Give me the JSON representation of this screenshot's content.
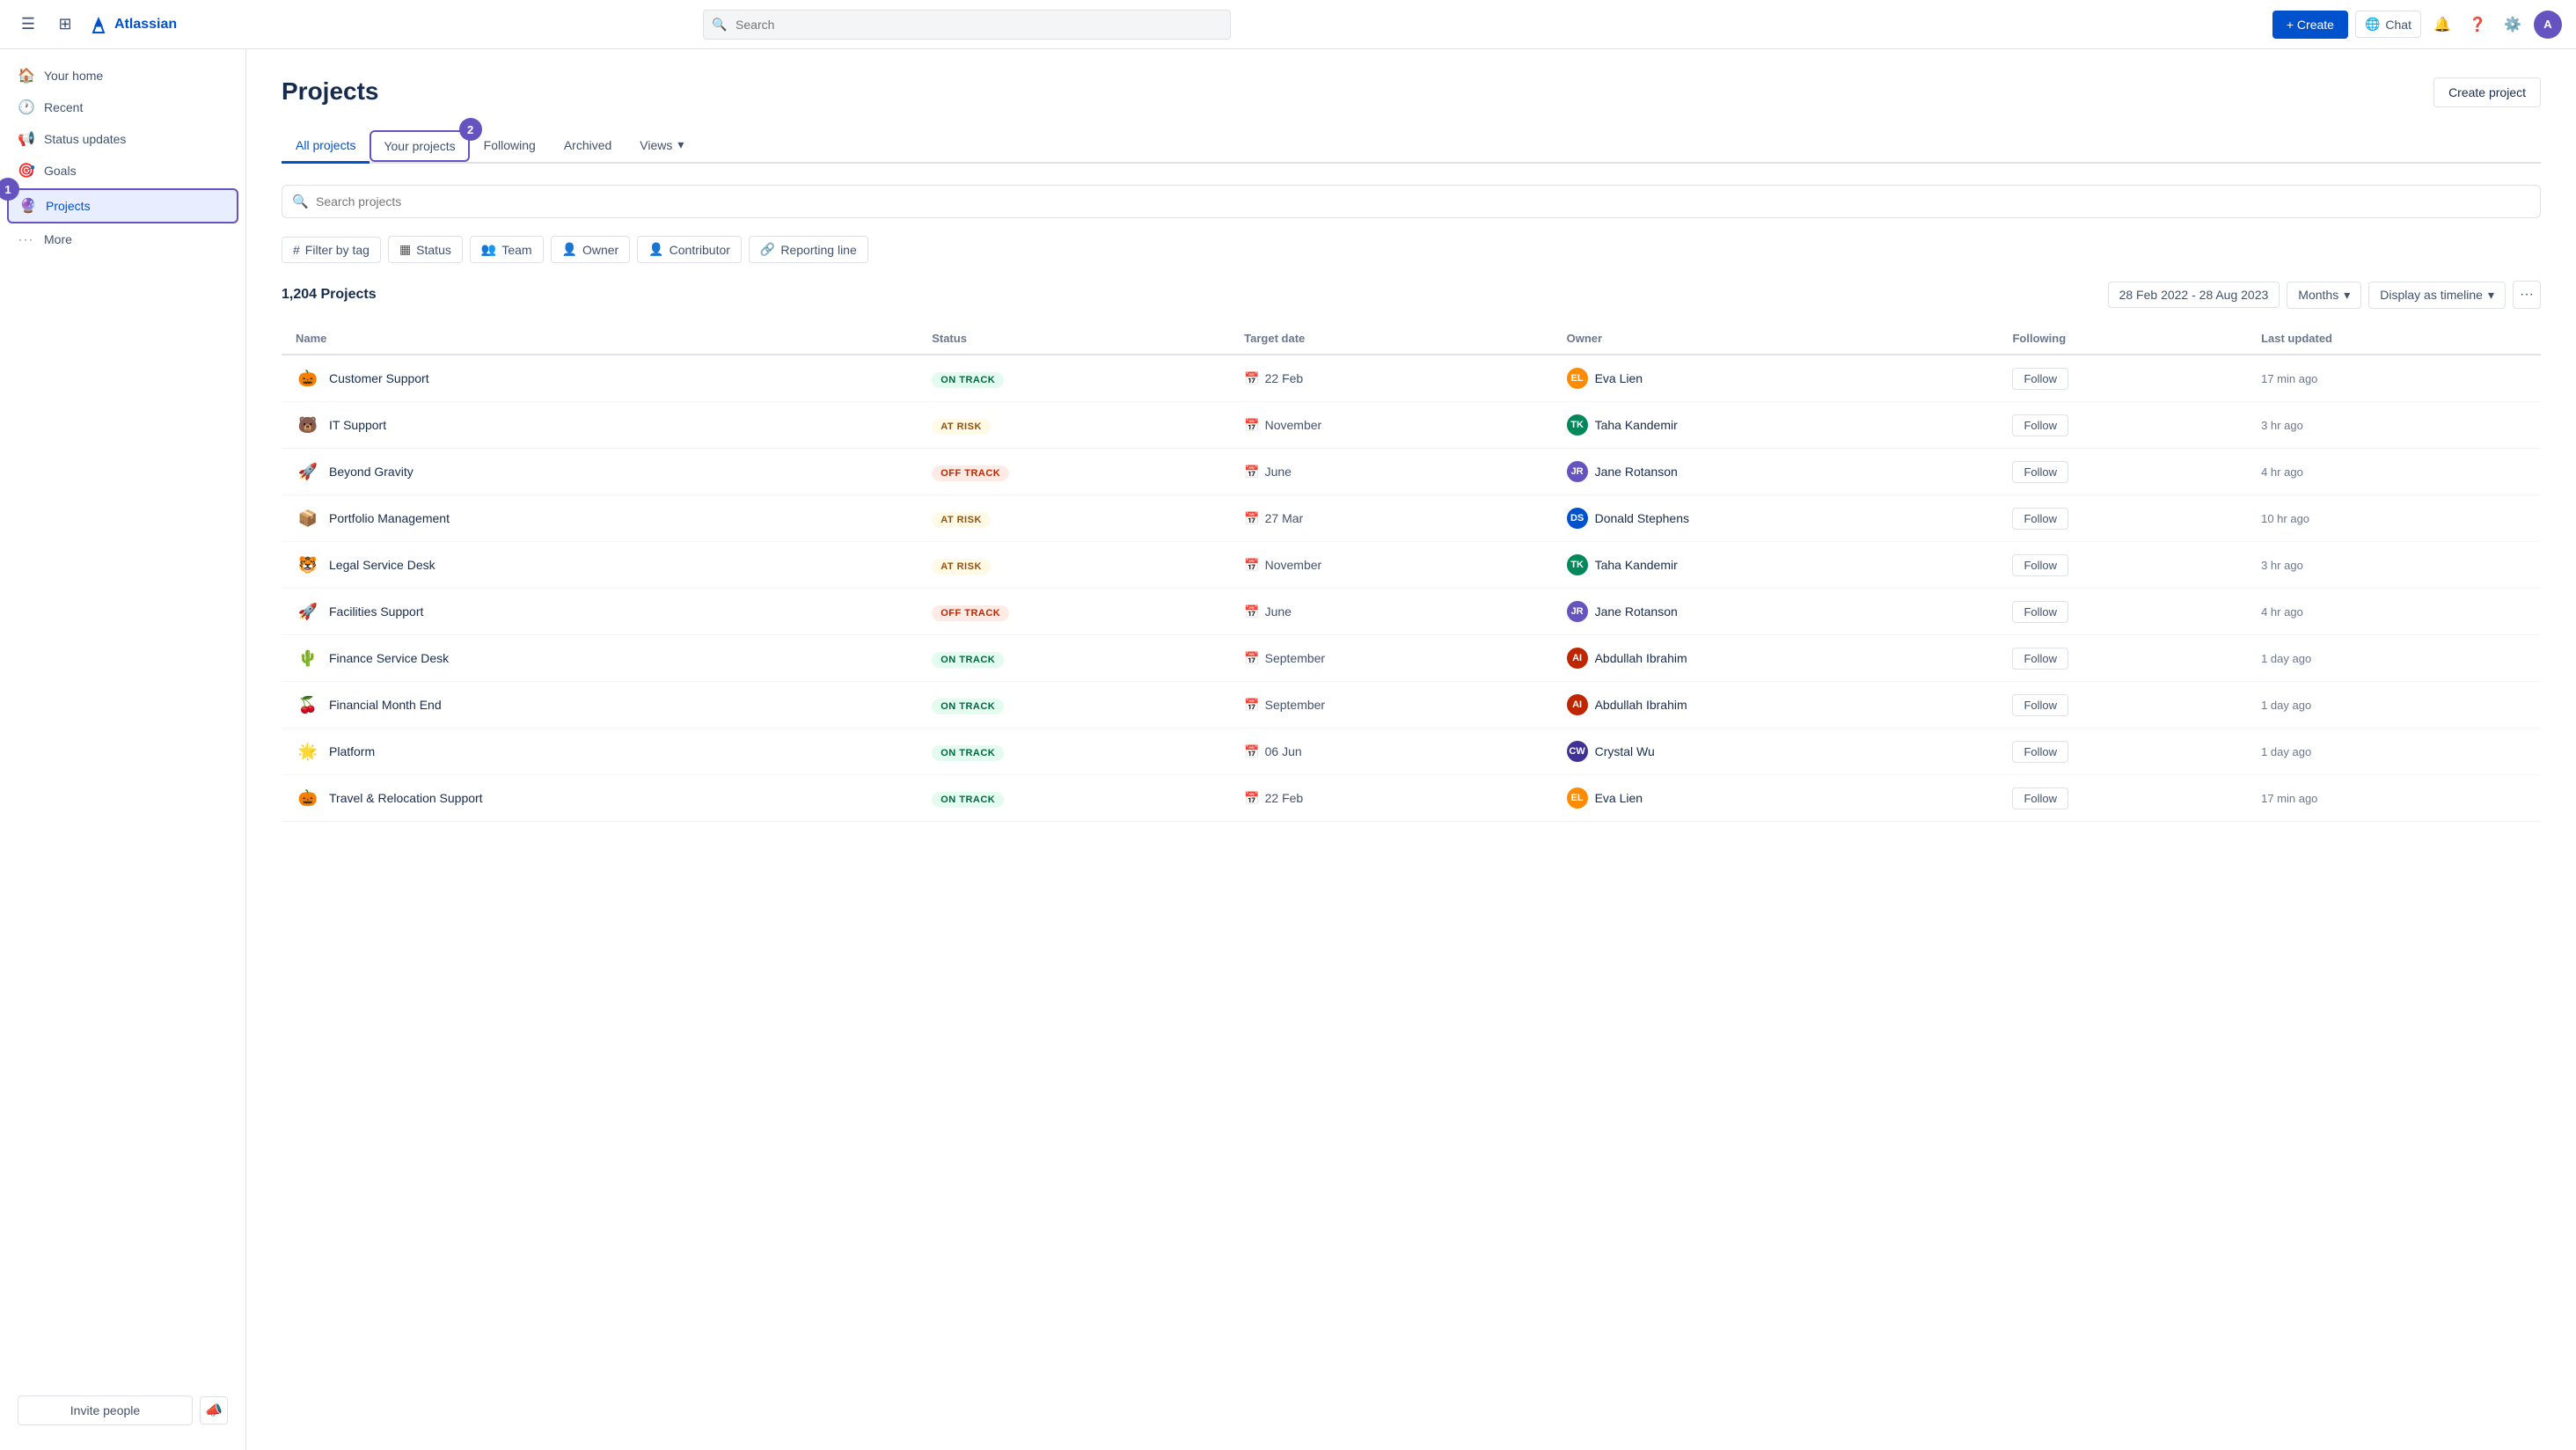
{
  "topnav": {
    "search_placeholder": "Search",
    "create_label": "+ Create",
    "chat_label": "Chat"
  },
  "sidebar": {
    "items": [
      {
        "id": "your-home",
        "label": "Your home",
        "icon": "🏠"
      },
      {
        "id": "recent",
        "label": "Recent",
        "icon": "🕐"
      },
      {
        "id": "status-updates",
        "label": "Status updates",
        "icon": "📢"
      },
      {
        "id": "goals",
        "label": "Goals",
        "icon": "🎯"
      },
      {
        "id": "projects",
        "label": "Projects",
        "icon": "🔮",
        "active": true
      },
      {
        "id": "more",
        "label": "More",
        "icon": "···"
      }
    ],
    "badge1_label": "1",
    "invite_label": "Invite people"
  },
  "page": {
    "title": "Projects",
    "create_project_label": "Create project",
    "tabs": [
      {
        "id": "all-projects",
        "label": "All projects",
        "active": true
      },
      {
        "id": "your-projects",
        "label": "Your projects",
        "badge": "2"
      },
      {
        "id": "following",
        "label": "Following"
      },
      {
        "id": "archived",
        "label": "Archived"
      },
      {
        "id": "views",
        "label": "Views",
        "has_chevron": true
      }
    ],
    "search_projects_placeholder": "Search projects",
    "filters": [
      {
        "id": "filter-by-tag",
        "label": "Filter by tag",
        "icon": "#"
      },
      {
        "id": "status",
        "label": "Status",
        "icon": "▦"
      },
      {
        "id": "team",
        "label": "Team",
        "icon": "👥"
      },
      {
        "id": "owner",
        "label": "Owner",
        "icon": "👤"
      },
      {
        "id": "contributor",
        "label": "Contributor",
        "icon": "👤"
      },
      {
        "id": "reporting-line",
        "label": "Reporting line",
        "icon": "🔗"
      }
    ],
    "count_label": "1,204 Projects",
    "date_range": "28 Feb 2022 - 28 Aug 2023",
    "months_label": "Months",
    "display_label": "Display as timeline",
    "table": {
      "columns": [
        {
          "id": "name",
          "label": "Name"
        },
        {
          "id": "status",
          "label": "Status"
        },
        {
          "id": "target-date",
          "label": "Target date"
        },
        {
          "id": "owner",
          "label": "Owner"
        },
        {
          "id": "following",
          "label": "Following"
        },
        {
          "id": "last-updated",
          "label": "Last updated"
        }
      ],
      "rows": [
        {
          "id": "customer-support",
          "emoji": "🎃",
          "name": "Customer Support",
          "status": "ON TRACK",
          "status_class": "on-track",
          "target_date": "22 Feb",
          "owner_name": "Eva Lien",
          "owner_color": "#FF8B00",
          "owner_initials": "EL",
          "follow_label": "Follow",
          "last_updated": "17 min ago"
        },
        {
          "id": "it-support",
          "emoji": "🐻",
          "name": "IT Support",
          "status": "AT RISK",
          "status_class": "at-risk",
          "target_date": "November",
          "owner_name": "Taha Kandemir",
          "owner_color": "#00875a",
          "owner_initials": "TK",
          "follow_label": "Follow",
          "last_updated": "3 hr ago"
        },
        {
          "id": "beyond-gravity",
          "emoji": "🚀",
          "name": "Beyond Gravity",
          "status": "OFF TRACK",
          "status_class": "off-track",
          "target_date": "June",
          "owner_name": "Jane Rotanson",
          "owner_color": "#6554c0",
          "owner_initials": "JR",
          "follow_label": "Follow",
          "last_updated": "4 hr ago"
        },
        {
          "id": "portfolio-management",
          "emoji": "📦",
          "name": "Portfolio Management",
          "status": "AT RISK",
          "status_class": "at-risk",
          "target_date": "27 Mar",
          "owner_name": "Donald Stephens",
          "owner_color": "#0052cc",
          "owner_initials": "DS",
          "follow_label": "Follow",
          "last_updated": "10 hr ago"
        },
        {
          "id": "legal-service-desk",
          "emoji": "🐯",
          "name": "Legal Service Desk",
          "status": "AT RISK",
          "status_class": "at-risk",
          "target_date": "November",
          "owner_name": "Taha Kandemir",
          "owner_color": "#00875a",
          "owner_initials": "TK",
          "follow_label": "Follow",
          "last_updated": "3 hr ago"
        },
        {
          "id": "facilities-support",
          "emoji": "🚀",
          "name": "Facilities Support",
          "status": "OFF TRACK",
          "status_class": "off-track",
          "target_date": "June",
          "owner_name": "Jane Rotanson",
          "owner_color": "#6554c0",
          "owner_initials": "JR",
          "follow_label": "Follow",
          "last_updated": "4 hr ago"
        },
        {
          "id": "finance-service-desk",
          "emoji": "🌵",
          "name": "Finance Service Desk",
          "status": "ON TRACK",
          "status_class": "on-track",
          "target_date": "September",
          "owner_name": "Abdullah Ibrahim",
          "owner_color": "#bf2600",
          "owner_initials": "AI",
          "follow_label": "Follow",
          "last_updated": "1 day ago"
        },
        {
          "id": "financial-month-end",
          "emoji": "🍒",
          "name": "Financial Month End",
          "status": "ON TRACK",
          "status_class": "on-track",
          "target_date": "September",
          "owner_name": "Abdullah Ibrahim",
          "owner_color": "#bf2600",
          "owner_initials": "AI",
          "follow_label": "Follow",
          "last_updated": "1 day ago"
        },
        {
          "id": "platform",
          "emoji": "🌟",
          "name": "Platform",
          "status": "ON TRACK",
          "status_class": "on-track",
          "target_date": "06 Jun",
          "owner_name": "Crystal Wu",
          "owner_color": "#403294",
          "owner_initials": "CW",
          "follow_label": "Follow",
          "last_updated": "1 day ago"
        },
        {
          "id": "travel-relocation",
          "emoji": "🎃",
          "name": "Travel & Relocation Support",
          "status": "ON TRACK",
          "status_class": "on-track",
          "target_date": "22 Feb",
          "owner_name": "Eva Lien",
          "owner_color": "#FF8B00",
          "owner_initials": "EL",
          "follow_label": "Follow",
          "last_updated": "17 min ago"
        }
      ]
    }
  }
}
